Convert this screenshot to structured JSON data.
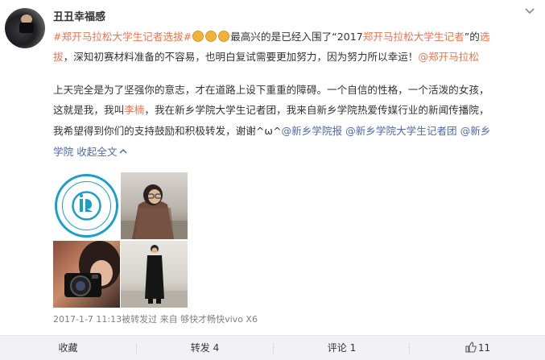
{
  "post": {
    "username": "丑丑幸福感",
    "line1": {
      "topic": "#郑开马拉松大学生记者选拔#",
      "text_a": "最高兴的是已经入围了“2017",
      "link": "郑开马拉松大学生记者",
      "text_b": "”的",
      "tail_link": "选"
    },
    "line2": {
      "link_start": "拔",
      "text": "，深知初赛材料准备的不容易，也明白复试需要更加努力，因为努力所以幸运！",
      "mention_icon": "@",
      "link_end": "郑开马拉松"
    },
    "line3": "上天完全是为了坚强你的意志，才在道路上设下重重的障碍。一个自信的性格，一个活泼的女孩，",
    "line4": {
      "text_a": "这就是我，我叫",
      "name": "李楠",
      "text_b": "，我在新乡学院大学生记者团，我来自新乡学院热爱传媒行业的新闻传播院，"
    },
    "line5": {
      "text": "我希望得到你们的支持鼓励和积极转发，谢谢^ω^",
      "mention1": "@新乡学院报",
      "mention2": "@新乡学院大学生记者团",
      "mention3_start": "@新乡"
    },
    "line6": {
      "mention3_end": "学院",
      "collapse": "收起全文",
      "collapse_icon": "chevron-up-icon"
    },
    "meta": "2017-1-7 11:13被转发过 来自 够快才畅快vivo X6"
  },
  "images": [
    {
      "name": "logo-image"
    },
    {
      "name": "portrait-image"
    },
    {
      "name": "camera-image"
    },
    {
      "name": "fullbody-image"
    }
  ],
  "footer": {
    "favorite": "收藏",
    "repost": "转发 4",
    "comment": "评论 1",
    "like_count": "11",
    "like_icon": "thumbs-up-icon"
  },
  "colors": {
    "link": "#eb7350",
    "mention": "#4d6aa8",
    "footer_bg": "#f2f2f5"
  }
}
